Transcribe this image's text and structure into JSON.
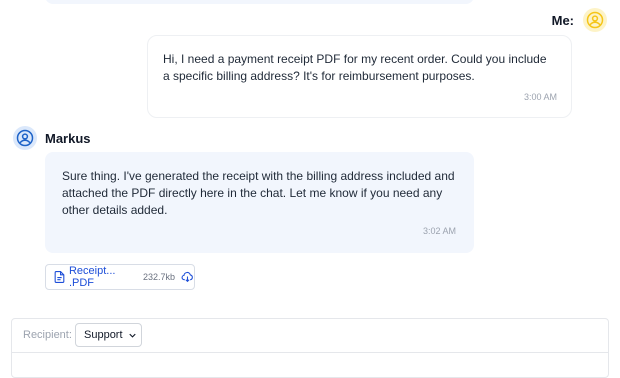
{
  "me": {
    "label": "Me:",
    "message": "Hi, I need a payment receipt PDF for my recent order. Could you include a specific billing address? It's for reimbursement purposes.",
    "time": "3:00 AM",
    "avatar_icon": "user-circle-icon",
    "avatar_color": "#f5c518"
  },
  "agent": {
    "name": "Markus",
    "message": "Sure thing. I've generated the receipt with the billing address included and attached the PDF directly here in the chat. Let me know if you need any other details added.",
    "time": "3:02 AM",
    "avatar_icon": "user-circle-icon",
    "avatar_color": "#1e63c8"
  },
  "attachment": {
    "name": "Receipt... .PDF",
    "size": "232.7kb",
    "file_icon": "file-icon",
    "download_icon": "cloud-download-icon",
    "link_color": "#1d4ed8"
  },
  "composer": {
    "recipient_label": "Recipient:",
    "recipient_value": "Support",
    "chevron_icon": "chevron-down-icon"
  }
}
